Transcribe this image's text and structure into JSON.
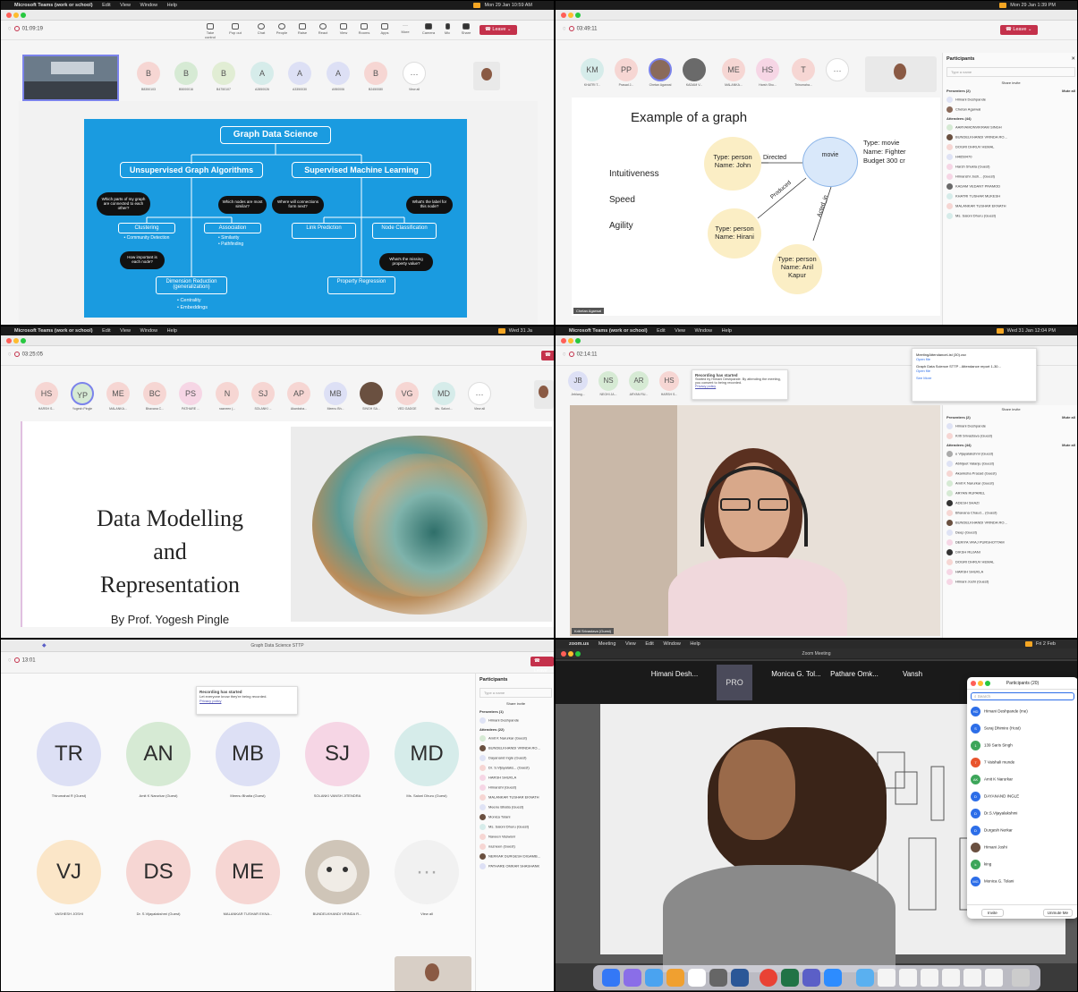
{
  "panel1": {
    "menubar": [
      "Microsoft Teams (work or school)",
      "Edit",
      "View",
      "Window",
      "Help"
    ],
    "clock": "Mon 29 Jan 10:59 AM",
    "timer": "01:09:19",
    "toolbar": [
      "Take control",
      "Pop out",
      "Chat",
      "People",
      "Raise",
      "React",
      "View",
      "Rooms",
      "Apps",
      "More",
      "Camera",
      "Mic",
      "Share"
    ],
    "leave": "Leave",
    "people_count": "60",
    "avatars": [
      {
        "initial": "B",
        "name": "B8350103",
        "color": "#f6d6d3"
      },
      {
        "initial": "B",
        "name": "B5000016",
        "color": "#d6ead4"
      },
      {
        "initial": "B",
        "name": "B4750107",
        "color": "#e1edd4"
      },
      {
        "initial": "A",
        "name": "A2850026",
        "color": "#d6ecea"
      },
      {
        "initial": "A",
        "name": "A3350030",
        "color": "#dde0f5"
      },
      {
        "initial": "A",
        "name": "A950006",
        "color": "#dde0f5"
      },
      {
        "initial": "B",
        "name": "B2450080",
        "color": "#f6d6d3"
      }
    ],
    "view_all": "View all",
    "slide": {
      "title": "Graph Data Science",
      "unsupervised": "Unsupervised Graph Algorithms",
      "supervised": "Supervised Machine Learning",
      "q1": "Which parts of my graph are connected to each other?",
      "q2": "Which nodes are most similar?",
      "q3": "Where will connections form next?",
      "q4": "What's the label for this node?",
      "q5": "How important is each node?",
      "q6": "What's the missing property value?",
      "clustering": "Clustering",
      "clustering_sub": "• Community Detection",
      "association": "Association",
      "association_sub1": "• Similarity",
      "association_sub2": "• Pathfinding",
      "link": "Link Prediction",
      "nodecls": "Node Classification",
      "dimred": "Dimension Reduction (generalization)",
      "dimred_sub1": "• Centrality",
      "dimred_sub2": "• Embeddings",
      "propreg": "Property Regression"
    }
  },
  "panel2": {
    "clock": "Mon 29 Jan 1:39 PM",
    "timer": "03:49:11",
    "leave": "Leave",
    "avatars": [
      {
        "initial": "KM",
        "name": "KHATRI T...",
        "color": "#d6ecea"
      },
      {
        "initial": "PP",
        "name": "Prasad J...",
        "color": "#f6d6d3"
      },
      {
        "initial": "",
        "name": "Chetan Agarwal",
        "color": "#8a6a5a"
      },
      {
        "initial": "",
        "name": "KADAM V...",
        "color": "#6a6a6a"
      },
      {
        "initial": "ME",
        "name": "MALANKA...",
        "color": "#f6d6d3"
      },
      {
        "initial": "HS",
        "name": "Harsh Shu...",
        "color": "#f6d6e5"
      },
      {
        "initial": "T",
        "name": "Thirumaha...",
        "color": "#f6d6d3"
      }
    ],
    "participants_title": "Participants",
    "search_placeholder": "Type a name",
    "share_invite": "Share invite",
    "presenters": "Presenters (2)",
    "mute_all": "Mute all",
    "attendees": "Attendees (44)",
    "people": [
      {
        "initial": "HD",
        "name": "Himani Deshpande"
      },
      {
        "initial": "CA",
        "name": "Chetan Agarwal"
      },
      {
        "initial": "AS",
        "name": "AARYAMONVIKRAM SINGH"
      },
      {
        "initial": "BV",
        "name": "BUNDELKHANDI VRINDA RO..."
      },
      {
        "initial": "DH",
        "name": "DOGRI DHRUV HEMAL"
      },
      {
        "initial": "H",
        "name": "H4650470"
      },
      {
        "initial": "HS",
        "name": "Harsh Shukla (Guest)"
      },
      {
        "initial": "HJ",
        "name": "Himanshi Josh... (Guest)"
      },
      {
        "initial": "KP",
        "name": "KADAM VEDANT PRAMOD"
      },
      {
        "initial": "KM",
        "name": "KHATRI TUSHAR MUKESH"
      },
      {
        "initial": "ME",
        "name": "MALANKAR TUSHAR EKNATH"
      },
      {
        "initial": "MD",
        "name": "Ms. Saloni Dhuru (Guest)"
      }
    ],
    "slide": {
      "title": "Example of a graph",
      "words": [
        "Intuitiveness",
        "Speed",
        "Agility"
      ],
      "node_person1": "Type: person\nName: John",
      "node_movie": "movie",
      "movie_props": "Type: movie\nName: Fighter\nBudget 300 cr",
      "node_person2": "Type: person\nName: Hirani",
      "node_person3": "Type: person\nName: Anil\nKapur",
      "edge_directed": "Directed",
      "edge_produced": "Produced",
      "edge_acted": "Acted_in"
    },
    "presenter_tag": "Chetan Agarwal"
  },
  "panel3": {
    "menubar": [
      "Microsoft Teams (work or school)",
      "Edit",
      "View",
      "Window",
      "Help"
    ],
    "clock": "Wed 31 Ja",
    "timer": "03:25:05",
    "avatars": [
      {
        "initial": "HS",
        "name": "HARSH S...",
        "color": "#f6d6d3"
      },
      {
        "initial": "YP",
        "name": "Yogesh Pingle",
        "color": "#d6ead4"
      },
      {
        "initial": "ME",
        "name": "MALANKA...",
        "color": "#f6d6d3"
      },
      {
        "initial": "BC",
        "name": "Bhavana C...",
        "color": "#f6d6d3"
      },
      {
        "initial": "PS",
        "name": "PATHARE ...",
        "color": "#f6d6e5"
      },
      {
        "initial": "N",
        "name": "nazneen (...",
        "color": "#f6d6d3"
      },
      {
        "initial": "SJ",
        "name": "SOLANKI ...",
        "color": "#f6d6d3"
      },
      {
        "initial": "AP",
        "name": "Akanksha...",
        "color": "#f6d6d3"
      },
      {
        "initial": "MB",
        "name": "Meenu Bh...",
        "color": "#dde0f5"
      },
      {
        "initial": "",
        "name": "SINGH SA...",
        "color": "#6a5040"
      },
      {
        "initial": "VG",
        "name": "VED GADGE",
        "color": "#f6d6d3"
      },
      {
        "initial": "MD",
        "name": "Ms. Saloni...",
        "color": "#d6ecea"
      }
    ],
    "view_all": "View all",
    "slide": {
      "title_line1": "Data Modelling",
      "title_line2": "and",
      "title_line3": "Representation",
      "byline": "By Prof. Yogesh Pingle"
    }
  },
  "panel4": {
    "menubar": [
      "Microsoft Teams (work or school)",
      "Edit",
      "View",
      "Window",
      "Help"
    ],
    "clock": "Wed 31 Jan 12:04 PM",
    "timer": "02:14:11",
    "avatars": [
      {
        "initial": "JB",
        "name": "Jeblang...",
        "color": "#dde0f5"
      },
      {
        "initial": "NS",
        "name": "NEGHI JA...",
        "color": "#d6ead4"
      },
      {
        "initial": "AR",
        "name": "ARYAN RU...",
        "color": "#d6ead4"
      },
      {
        "initial": "HS",
        "name": "HARSH S...",
        "color": "#f6d6d3"
      }
    ],
    "toast_title": "Recording has started",
    "toast_body": "Started by Himani Deshpande. By attending the meeting, you consent to being recorded.",
    "toast_link": "Privacy policy",
    "downloads": [
      "MeetingAttendanceList (30).csv",
      "Graph Data Science STTP - Attendance report 1-30..."
    ],
    "open_file": "Open file",
    "see_more": "See More",
    "share_invite": "Share invite",
    "presenters": "Presenters (2)",
    "attendees": "Attendees (44)",
    "mute_all": "Mute all",
    "people": [
      {
        "initial": "HD",
        "name": "Himani Deshpande"
      },
      {
        "initial": "KS",
        "name": "Kriti Srivastava (Guest)"
      },
      {
        "initial": "AV",
        "name": "e Vijayalakshmi (Guest)"
      },
      {
        "initial": "AV",
        "name": "Abhijeet Valanju (Guest)"
      },
      {
        "initial": "AP",
        "name": "Akanksha Prasad (Guest)"
      },
      {
        "initial": "AN",
        "name": "Amit K Narurkar (Guest)"
      },
      {
        "initial": "AR",
        "name": "ARYAN RUPAREL"
      },
      {
        "initial": "AS",
        "name": "ADESH SHAZI"
      },
      {
        "initial": "BC",
        "name": "Bhavana Chaud... (Guest)"
      },
      {
        "initial": "BV",
        "name": "BUNDELKHANDI VRINDA RO..."
      },
      {
        "initial": "D",
        "name": "Deep (Guest)"
      },
      {
        "initial": "DP",
        "name": "DERIYA VRAJ PURSHOTTAM"
      },
      {
        "initial": "DR",
        "name": "DIKSH RUJANI"
      },
      {
        "initial": "DH",
        "name": "DOGRI DHRUV HEMAL"
      },
      {
        "initial": "HS",
        "name": "HARSH SHUKLA"
      },
      {
        "initial": "HJ",
        "name": "Himani Joshi (Guest)"
      }
    ],
    "name_tag": "Kriti Srivastava (Guest)"
  },
  "panel5": {
    "window_title": "Graph Data Science STTP",
    "timer": "13:01",
    "leave": "Leave",
    "people_count": "23",
    "toast_title": "Recording has started",
    "toast_body": "Let everyone know they're being recorded.",
    "toast_link": "Privacy policy",
    "participants_title": "Participants",
    "search_placeholder": "Type a name",
    "share_invite": "Share invite",
    "presenters": "Presenters (1)",
    "attendees": "Attendees (22)",
    "tiles": [
      {
        "initial": "TR",
        "name": "Thirumahal R (Guest)",
        "color": "#dde0f5"
      },
      {
        "initial": "AN",
        "name": "Amit K Narurkar (Guest)",
        "color": "#d6ead4"
      },
      {
        "initial": "MB",
        "name": "Meenu Bhatia (Guest)",
        "color": "#dde0f5"
      },
      {
        "initial": "SJ",
        "name": "SOLANKI VANSH JITENDRA",
        "color": "#f6d6e5"
      },
      {
        "initial": "MD",
        "name": "Ms. Saloni Dhuru (Guest)",
        "color": "#d6ecea"
      },
      {
        "initial": "VJ",
        "name": "VASHESH JOSHI",
        "color": "#fbe6c8"
      },
      {
        "initial": "DS",
        "name": "Dr. S.Vijayalakshmi (Guest)",
        "color": "#f6d6d3"
      },
      {
        "initial": "ME",
        "name": "MALANKAR TUSHAR EKNA...",
        "color": "#f6d6d3"
      },
      {
        "initial": "",
        "name": "BUNDELKHANDI VRINDA R...",
        "color": "#cfc5b8"
      }
    ],
    "view_all": "View all",
    "people": [
      {
        "initial": "HD",
        "name": "Himani Deshpande"
      },
      {
        "initial": "AN",
        "name": "Amit K Narurkar (Guest)"
      },
      {
        "initial": "BV",
        "name": "BUNDELKHANDI VRINDA RO..."
      },
      {
        "initial": "DI",
        "name": "Dayanand Ingle (Guest)"
      },
      {
        "initial": "DS",
        "name": "Dr. S.Vijayalaks... (Guest)"
      },
      {
        "initial": "HS",
        "name": "HARSH SHUKLA"
      },
      {
        "initial": "H",
        "name": "Himanshi (Guest)"
      },
      {
        "initial": "ME",
        "name": "MALANKAR TUSHAR EKNATH"
      },
      {
        "initial": "MB",
        "name": "Meenu Bhatia (Guest)"
      },
      {
        "initial": "MT",
        "name": "Monica Tolani"
      },
      {
        "initial": "MD",
        "name": "Ms. Saloni Dhuru (Guest)"
      },
      {
        "initial": "NV",
        "name": "Naveen Vaswani"
      },
      {
        "initial": "N",
        "name": "nazneen (Guest)"
      },
      {
        "initial": "ND",
        "name": "NERKAR DURGESH DIGAMB..."
      },
      {
        "initial": "PS",
        "name": "PATHARE OMKAR SHASHANK"
      }
    ]
  },
  "panel6": {
    "menubar": [
      "zoom.us",
      "Meeting",
      "View",
      "Edit",
      "Window",
      "Help"
    ],
    "clock": "Fri 2 Feb",
    "window_title": "Zoom Meeting",
    "strip": [
      "Himani Desh...",
      "",
      "Monica G. Tol...",
      "Pathare Omk...",
      "Vansh"
    ],
    "participants_title": "Participants (20)",
    "search_placeholder": "Search",
    "people": [
      {
        "initial": "HD",
        "name": "Himani Deshpande (me)",
        "color": "#2d6ee8"
      },
      {
        "initial": "S",
        "name": "Suraj Dhimire (Host)",
        "color": "#2d6ee8"
      },
      {
        "initial": "1",
        "name": "139 Saris Singh",
        "color": "#3da65a"
      },
      {
        "initial": "7",
        "name": "7 Vaishali munde",
        "color": "#e8542d"
      },
      {
        "initial": "AK",
        "name": "Amit K Narurkar",
        "color": "#3da65a"
      },
      {
        "initial": "D",
        "name": "DAYANAND INGLE",
        "color": "#2d6ee8"
      },
      {
        "initial": "D",
        "name": "Dr.S.Vijayalakshmi",
        "color": "#2d6ee8"
      },
      {
        "initial": "D",
        "name": "Durgesh Nerkar",
        "color": "#2d6ee8"
      },
      {
        "initial": "",
        "name": "Himani Joshi",
        "color": "#6a5040"
      },
      {
        "initial": "k",
        "name": "king",
        "color": "#3da65a"
      },
      {
        "initial": "MG",
        "name": "Monica G. Tolani",
        "color": "#2d6ee8"
      }
    ],
    "invite": "Invite",
    "unmute": "Unmute Me"
  }
}
